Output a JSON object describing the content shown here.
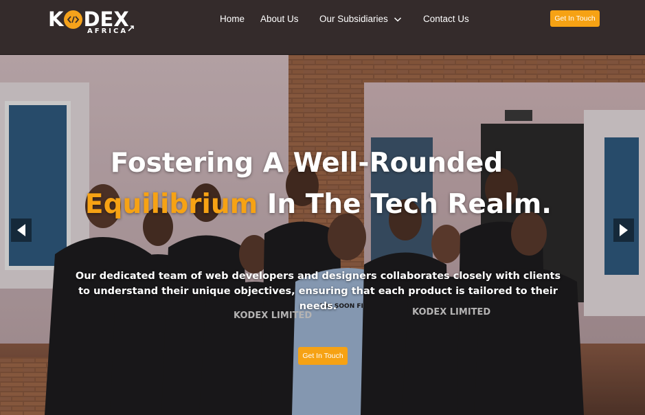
{
  "header": {
    "logo_main_left": "K",
    "logo_main_right": "DEX",
    "logo_sub": "AFRICA",
    "nav": {
      "home": "Home",
      "about": "About Us",
      "subsidiaries": "Our Subsidiaries",
      "contact": "Contact Us"
    },
    "cta_label": "Get In Touch"
  },
  "hero": {
    "headline_line1": "Fostering A Well-Rounded",
    "headline_accent": "Equilibrium",
    "headline_rest": " In The Tech Realm.",
    "paragraph": "Our dedicated team of web developers and designers collaborates closely with clients to understand their unique objectives, ensuring that each product is tailored to their needs.",
    "cta_label": "Get In Touch",
    "shirt_text": "KODEX LIMITED",
    "shirt_text_2": "100 SOON FIX"
  },
  "colors": {
    "header_bg": "#342b2b",
    "accent": "#f6a214",
    "text": "#ffffff"
  },
  "icons": {
    "logo": "code-brackets-icon",
    "dropdown": "chevron-down-icon",
    "prev": "triangle-left-icon",
    "next": "triangle-right-icon"
  }
}
